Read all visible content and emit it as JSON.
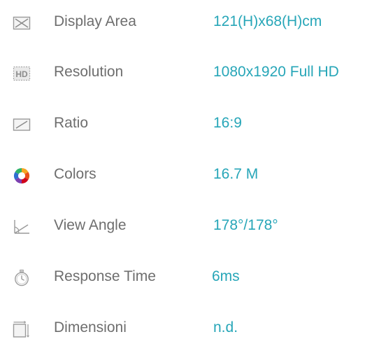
{
  "specs": [
    {
      "icon": "display-area-icon",
      "label": "Display Area",
      "value": "121(H)x68(H)cm"
    },
    {
      "icon": "hd-resolution-icon",
      "label": "Resolution",
      "value": "1080x1920 Full HD"
    },
    {
      "icon": "ratio-icon",
      "label": "Ratio",
      "value": "16:9"
    },
    {
      "icon": "color-wheel-icon",
      "label": "Colors",
      "value": "16.7 M"
    },
    {
      "icon": "view-angle-icon",
      "label": "View Angle",
      "value": "178°/178°"
    },
    {
      "icon": "stopwatch-icon",
      "label": "Response Time",
      "value": "6ms"
    },
    {
      "icon": "dimensions-icon",
      "label": "Dimensioni",
      "value": "n.d."
    }
  ],
  "colors": {
    "label": "#6e6e6e",
    "value": "#27a6b8",
    "icon_stroke": "#9a9a9a"
  }
}
